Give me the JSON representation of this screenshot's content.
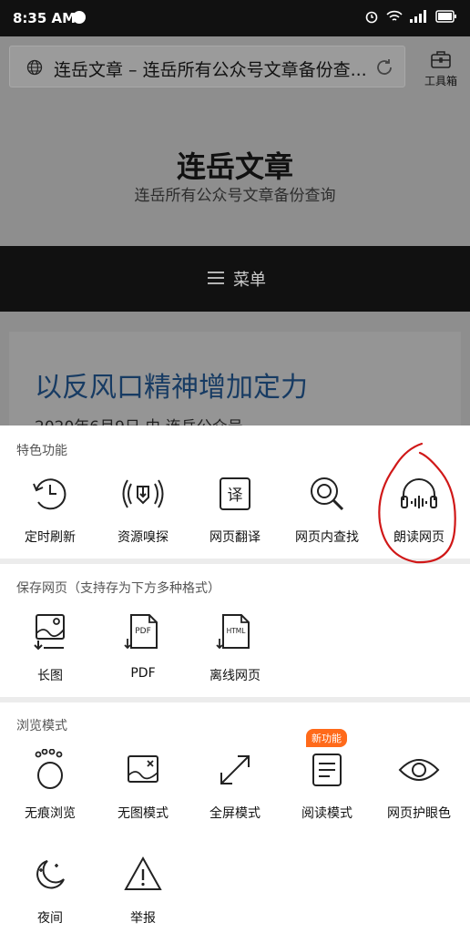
{
  "status_bar": {
    "time": "8:35 AM"
  },
  "browser": {
    "url_text": "连岳文章 – 连岳所有公众号文章备份查...",
    "toolbox_label": "工具箱"
  },
  "page": {
    "site_title": "连岳文章",
    "site_subtitle": "连岳所有公众号文章备份查询",
    "menu_label": "菜单",
    "article_title": "以反风口精神增加定力",
    "article_meta": "2020年6月9日 由 连岳公众号"
  },
  "sheet": {
    "featured": {
      "label": "特色功能",
      "items": [
        {
          "label": "定时刷新",
          "icon": "timer-refresh-icon"
        },
        {
          "label": "资源嗅探",
          "icon": "resource-sniff-icon"
        },
        {
          "label": "网页翻译",
          "icon": "translate-icon"
        },
        {
          "label": "网页内查找",
          "icon": "find-in-page-icon"
        },
        {
          "label": "朗读网页",
          "icon": "headphones-icon"
        }
      ]
    },
    "save": {
      "label": "保存网页（支持存为下方多种格式）",
      "items": [
        {
          "label": "长图",
          "icon": "long-image-icon"
        },
        {
          "label": "PDF",
          "icon": "pdf-file-icon",
          "icon_text": "PDF"
        },
        {
          "label": "离线网页",
          "icon": "html-file-icon",
          "icon_text": "HTML"
        }
      ]
    },
    "browse": {
      "label": "浏览模式",
      "new_badge": "新功能",
      "items": [
        {
          "label": "无痕浏览",
          "icon": "incognito-icon"
        },
        {
          "label": "无图模式",
          "icon": "no-image-icon"
        },
        {
          "label": "全屏模式",
          "icon": "fullscreen-icon"
        },
        {
          "label": "阅读模式",
          "icon": "reading-mode-icon"
        },
        {
          "label": "网页护眼色",
          "icon": "eye-icon"
        },
        {
          "label": "夜间",
          "icon": "night-icon"
        },
        {
          "label": "举报",
          "icon": "report-icon"
        }
      ]
    }
  },
  "colors": {
    "accent_badge": "#ff6a1a",
    "annotation_red": "#d01818",
    "article_link": "#173b63"
  }
}
